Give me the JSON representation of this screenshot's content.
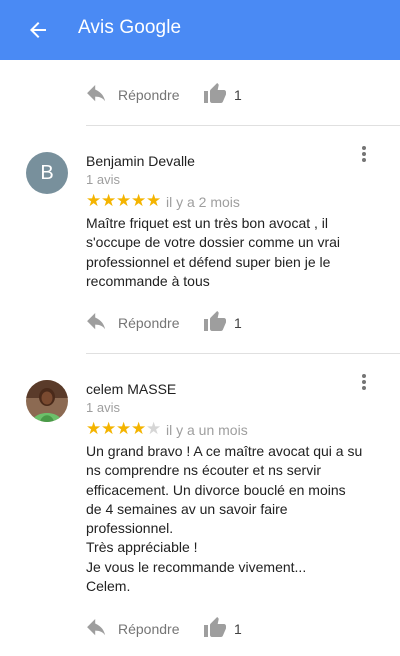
{
  "appbar": {
    "title": "Avis Google",
    "back_icon": "arrow-back-icon",
    "background": "#4a8af4"
  },
  "common": {
    "reply_label": "Répondre"
  },
  "first_partial_review": {
    "likes": "1"
  },
  "reviews": [
    {
      "author": "Benjamin Devalle",
      "avatar_letter": "B",
      "review_count": "1 avis",
      "rating": 5,
      "date": "il y a 2 mois",
      "text": "Maître friquet est un très bon avocat , il\ns'occupe de votre dossier comme un vrai\nprofessionnel et défend super bien je le\nrecommande à tous",
      "likes": "1"
    },
    {
      "author": "celem MASSE",
      "review_count": "1 avis",
      "rating": 4,
      "date": "il y a un mois",
      "text": "Un grand bravo ! A ce maître avocat qui a su\nns comprendre ns écouter et ns servir\nefficacement.  Un divorce bouclé en moins\nde 4 semaines av un savoir faire\nprofessionnel.\nTrès appréciable !\nJe vous le recommande vivement...\nCelem.",
      "likes": "1"
    }
  ],
  "colors": {
    "star_filled": "#f4b400",
    "star_empty": "#d6d6d6"
  }
}
